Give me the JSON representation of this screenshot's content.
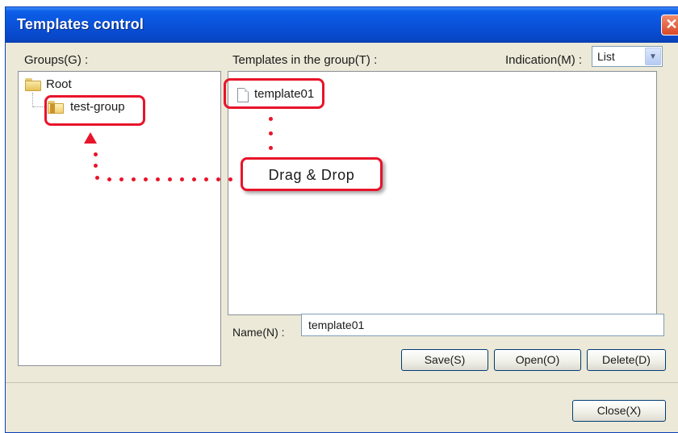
{
  "window": {
    "title": "Templates control",
    "close_glyph": "✕"
  },
  "groups": {
    "label": "Groups(G) :",
    "tree": [
      {
        "label": "Root",
        "icon": "folder-icon"
      },
      {
        "label": "test-group",
        "icon": "open-folder-icon"
      }
    ]
  },
  "templates": {
    "label": "Templates in the group(T) :",
    "items": [
      {
        "label": "template01",
        "icon": "document-icon"
      }
    ]
  },
  "indication": {
    "label": "Indication(M) :",
    "selected": "List"
  },
  "name": {
    "label": "Name(N) :",
    "value": "template01"
  },
  "buttons": {
    "save": "Save(S)",
    "open": "Open(O)",
    "delete": "Delete(D)",
    "close": "Close(X)"
  },
  "annotation": {
    "text": "Drag & Drop",
    "color": "#e8142a"
  },
  "colors": {
    "titlebar": "#0a52d9",
    "dialog_bg": "#ece9d8",
    "accent_red": "#e8142a"
  }
}
